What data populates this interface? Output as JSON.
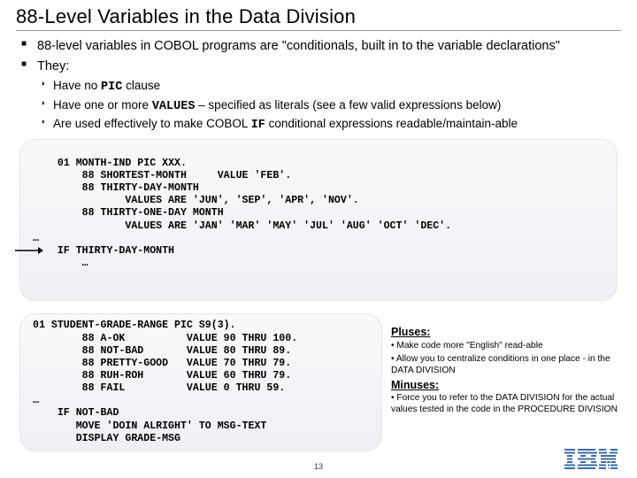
{
  "title": "88-Level Variables in the Data Division",
  "b1": "88-level variables in COBOL programs are \"conditionals, built in to the variable declarations\"",
  "b2": "They:",
  "sb1_pre": "Have no ",
  "sb1_kw": "PIC",
  "sb1_post": " clause",
  "sb2_pre": "Have one or more ",
  "sb2_kw": "VALUES",
  "sb2_post": " – specified as literals (see a few valid expressions below)",
  "sb3_pre": "Are used effectively to make COBOL ",
  "sb3_kw": "IF",
  "sb3_post": " conditional expressions readable/maintain-able",
  "code1": "01 MONTH-IND PIC XXX.\n        88 SHORTEST-MONTH     VALUE 'FEB'.\n        88 THIRTY-DAY-MONTH\n               VALUES ARE 'JUN', 'SEP', 'APR', 'NOV'.\n        88 THIRTY-ONE-DAY MONTH\n               VALUES ARE 'JAN' 'MAR' 'MAY' 'JUL' 'AUG' 'OCT' 'DEC'.\n…\n    IF THIRTY-DAY-MONTH\n        …",
  "code2": "01 STUDENT-GRADE-RANGE PIC S9(3).\n        88 A-OK          VALUE 90 THRU 100.\n        88 NOT-BAD       VALUE 80 THRU 89.\n        88 PRETTY-GOOD   VALUE 70 THRU 79.\n        88 RUH-ROH       VALUE 60 THRU 79.\n        88 FAIL          VALUE 0 THRU 59.\n…\n    IF NOT-BAD\n       MOVE 'DOIN ALRIGHT' TO MSG-TEXT\n       DISPLAY GRADE-MSG",
  "pluses_hdr": "Pluses:",
  "plus1": "• Make code more \"English\" read-able",
  "plus2": "• Allow you to centralize conditions in one place - in the DATA DIVISION",
  "minuses_hdr": "Minuses:",
  "minus1": "• Force you to refer to the DATA DIVISION for the actual values tested in the code in the PROCEDURE DIVISION",
  "pagenum": "13",
  "logo_alt": "IBM"
}
